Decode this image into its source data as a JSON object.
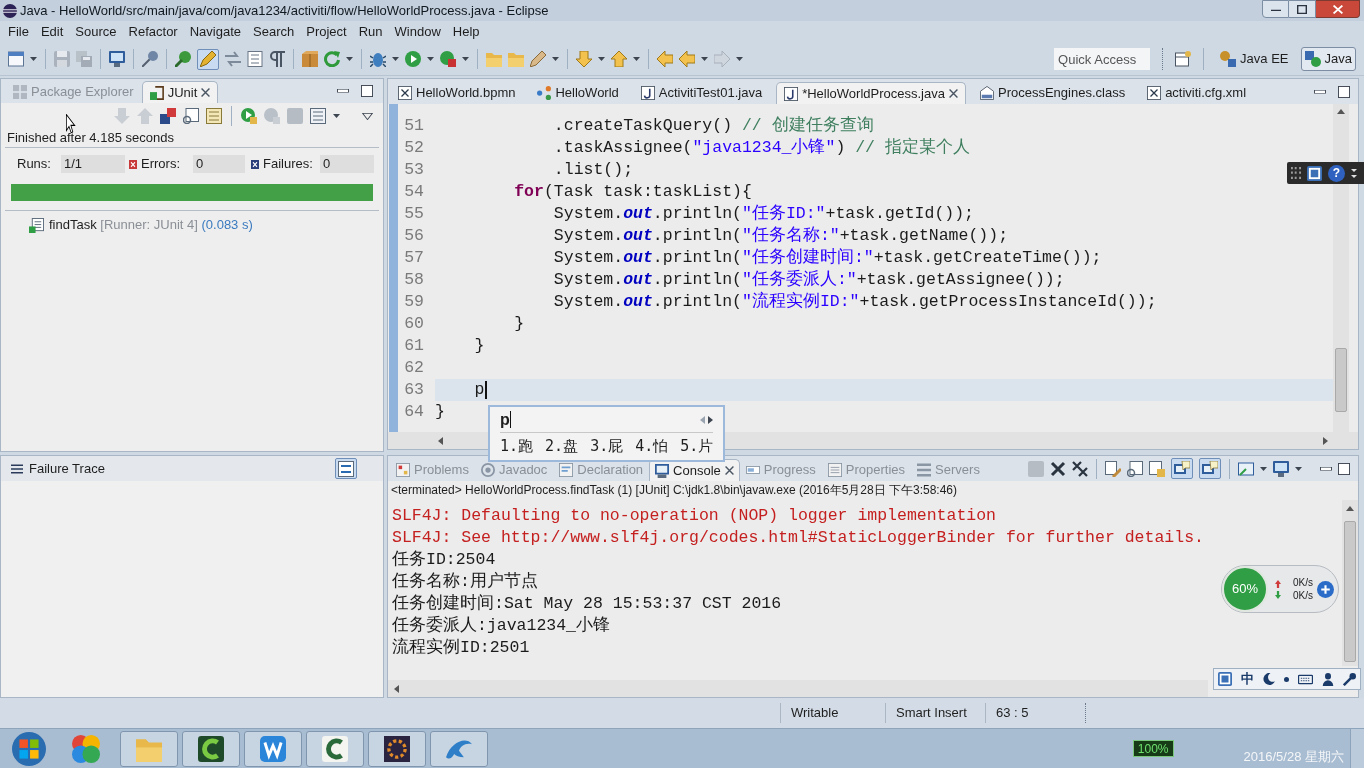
{
  "window": {
    "title": "Java - HelloWorld/src/main/java/com/java1234/activiti/flow/HelloWorldProcess.java - Eclipse"
  },
  "menu_bar": [
    "File",
    "Edit",
    "Source",
    "Refactor",
    "Navigate",
    "Search",
    "Project",
    "Run",
    "Window",
    "Help"
  ],
  "toolbar": {
    "pen_toggle": {
      "pressed": true
    },
    "quick_access": {
      "placeholder": "Quick Access"
    },
    "perspectives": [
      {
        "label": "Java EE",
        "selected": false
      },
      {
        "label": "Java",
        "selected": true
      }
    ]
  },
  "junit_view": {
    "tabs": [
      {
        "label": "Package Explorer",
        "kind": "package",
        "selected": false
      },
      {
        "label": "JUnit",
        "kind": "junit",
        "selected": true
      }
    ],
    "status": "Finished after 4.185 seconds",
    "counters": [
      {
        "kind": "runs",
        "label": "Runs:",
        "value": "1/1"
      },
      {
        "kind": "errors",
        "label": "Errors:",
        "value": "0"
      },
      {
        "kind": "failures",
        "label": "Failures:",
        "value": "0"
      }
    ],
    "progress": {
      "level": 1
    },
    "tests": [
      {
        "name": "findTask",
        "runner": "[Runner: JUnit 4]",
        "time": "(0.083 s)"
      }
    ]
  },
  "failure_trace": {
    "title": "Failure Trace",
    "compare_toggle": {
      "pressed": true
    }
  },
  "editor": {
    "tabs": [
      {
        "label": "HelloWorld.bpmn",
        "kind": "xml",
        "selected": false
      },
      {
        "label": "HelloWorld",
        "kind": "diagram",
        "selected": false
      },
      {
        "label": "ActivitiTest01.java",
        "kind": "java",
        "selected": false
      },
      {
        "label": "*HelloWorldProcess.java",
        "kind": "java",
        "selected": true
      },
      {
        "label": "ProcessEngines.class",
        "kind": "class",
        "selected": false
      },
      {
        "label": "activiti.cfg.xml",
        "kind": "xml",
        "selected": false
      }
    ],
    "lines": [
      {
        "number": "51",
        "current": false,
        "tokens": [
          {
            "kind": "plain",
            "text": "            .createTaskQuery() "
          },
          {
            "kind": "comment",
            "text": "// 创建任务查询"
          }
        ]
      },
      {
        "number": "52",
        "current": false,
        "tokens": [
          {
            "kind": "plain",
            "text": "            .taskAssignee("
          },
          {
            "kind": "string",
            "text": "\"java1234_小锋\""
          },
          {
            "kind": "plain",
            "text": ") "
          },
          {
            "kind": "comment",
            "text": "// 指定某个人"
          }
        ]
      },
      {
        "number": "53",
        "current": false,
        "tokens": [
          {
            "kind": "plain",
            "text": "            .list();"
          }
        ]
      },
      {
        "number": "54",
        "current": false,
        "tokens": [
          {
            "kind": "keyword",
            "text": "        for"
          },
          {
            "kind": "plain",
            "text": "(Task task:taskList){"
          }
        ]
      },
      {
        "number": "55",
        "current": false,
        "tokens": [
          {
            "kind": "plain",
            "text": "            System."
          },
          {
            "kind": "field",
            "text": "out"
          },
          {
            "kind": "plain",
            "text": ".println("
          },
          {
            "kind": "string",
            "text": "\"任务ID:\""
          },
          {
            "kind": "plain",
            "text": "+task.getId());"
          }
        ]
      },
      {
        "number": "56",
        "current": false,
        "tokens": [
          {
            "kind": "plain",
            "text": "            System."
          },
          {
            "kind": "field",
            "text": "out"
          },
          {
            "kind": "plain",
            "text": ".println("
          },
          {
            "kind": "string",
            "text": "\"任务名称:\""
          },
          {
            "kind": "plain",
            "text": "+task.getName());"
          }
        ]
      },
      {
        "number": "57",
        "current": false,
        "tokens": [
          {
            "kind": "plain",
            "text": "            System."
          },
          {
            "kind": "field",
            "text": "out"
          },
          {
            "kind": "plain",
            "text": ".println("
          },
          {
            "kind": "string",
            "text": "\"任务创建时间:\""
          },
          {
            "kind": "plain",
            "text": "+task.getCreateTime());"
          }
        ]
      },
      {
        "number": "58",
        "current": false,
        "tokens": [
          {
            "kind": "plain",
            "text": "            System."
          },
          {
            "kind": "field",
            "text": "out"
          },
          {
            "kind": "plain",
            "text": ".println("
          },
          {
            "kind": "string",
            "text": "\"任务委派人:\""
          },
          {
            "kind": "plain",
            "text": "+task.getAssignee());"
          }
        ]
      },
      {
        "number": "59",
        "current": false,
        "tokens": [
          {
            "kind": "plain",
            "text": "            System."
          },
          {
            "kind": "field",
            "text": "out"
          },
          {
            "kind": "plain",
            "text": ".println("
          },
          {
            "kind": "string",
            "text": "\"流程实例ID:\""
          },
          {
            "kind": "plain",
            "text": "+task.getProcessInstanceId());"
          }
        ]
      },
      {
        "number": "60",
        "current": false,
        "tokens": [
          {
            "kind": "plain",
            "text": "        }"
          }
        ]
      },
      {
        "number": "61",
        "current": false,
        "tokens": [
          {
            "kind": "plain",
            "text": "    }"
          }
        ]
      },
      {
        "number": "62",
        "current": false
      },
      {
        "number": "63",
        "current": true,
        "tokens": [
          {
            "kind": "plain",
            "text": "    p"
          }
        ]
      },
      {
        "number": "64",
        "current": false,
        "tokens": [
          {
            "kind": "plain",
            "text": "}"
          }
        ]
      }
    ]
  },
  "ime_popup": {
    "input": "p",
    "candidates": [
      "1.跑",
      "2.盘",
      "3.屁",
      "4.怕",
      "5.片"
    ]
  },
  "console_view": {
    "tabs": [
      {
        "label": "Problems",
        "kind": "problems",
        "selected": false
      },
      {
        "label": "Javadoc",
        "kind": "javadoc",
        "selected": false
      },
      {
        "label": "Declaration",
        "kind": "declaration",
        "selected": false
      },
      {
        "label": "Console",
        "kind": "console",
        "selected": true
      },
      {
        "label": "Progress",
        "kind": "progress",
        "selected": false
      },
      {
        "label": "Properties",
        "kind": "properties",
        "selected": false
      },
      {
        "label": "Servers",
        "kind": "servers",
        "selected": false
      }
    ],
    "toggles": [
      {
        "pressed": true
      },
      {
        "pressed": true
      }
    ],
    "header": "<terminated> HelloWorldProcess.findTask (1) [JUnit] C:\\jdk1.8\\bin\\javaw.exe (2016年5月28日 下午3:58:46)",
    "output": [
      {
        "kind": "error",
        "text": "SLF4J: Defaulting to no-operation (NOP) logger implementation"
      },
      {
        "kind": "error",
        "text": "SLF4J: See http://www.slf4j.org/codes.html#StaticLoggerBinder for further details."
      },
      {
        "kind": "output",
        "text": "任务ID:2504"
      },
      {
        "kind": "output",
        "text": "任务名称:用户节点"
      },
      {
        "kind": "output",
        "text": "任务创建时间:Sat May 28 15:53:37 CST 2016"
      },
      {
        "kind": "output",
        "text": "任务委派人:java1234_小锋"
      },
      {
        "kind": "output",
        "text": "流程实例ID:2501"
      }
    ]
  },
  "status_bar": [
    "Writable",
    "Smart Insert",
    "63 : 5"
  ],
  "language_bar": {
    "help": "?"
  },
  "network_monitor": {
    "usage": "60%",
    "upload": "0K/s",
    "download": "0K/s"
  },
  "ime_status_bar": {
    "mode": "中"
  },
  "taskbar": {
    "battery": "100%",
    "date": "2016/5/28 星期六"
  }
}
